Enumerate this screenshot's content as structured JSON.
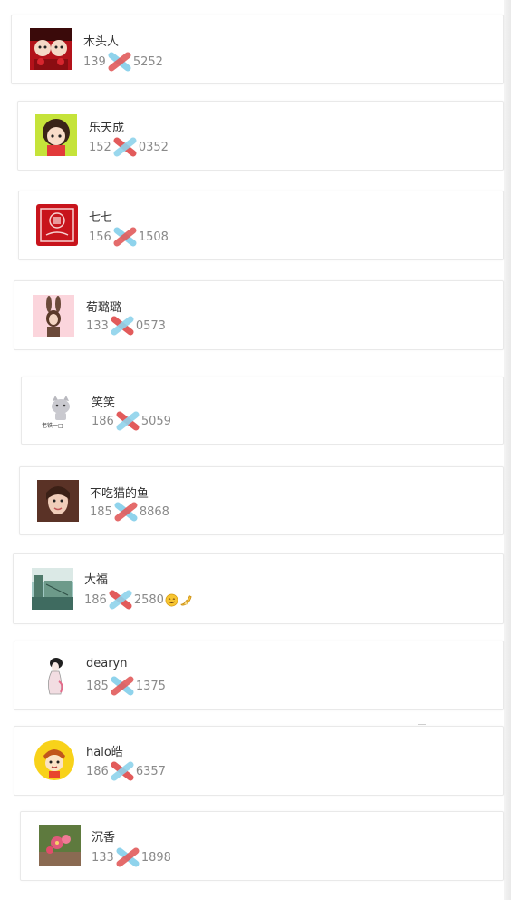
{
  "contacts": [
    {
      "name": "木头人",
      "phone_prefix": "139",
      "phone_suffix": "5252",
      "avatar_icon": "red-doll-avatar-icon"
    },
    {
      "name": "乐天成",
      "phone_prefix": "152",
      "phone_suffix": "0352",
      "avatar_icon": "cartoon-girl-avatar-icon"
    },
    {
      "name": "七七",
      "phone_prefix": "156",
      "phone_suffix": "1508",
      "avatar_icon": "red-seal-avatar-icon"
    },
    {
      "name": "荀璐璐",
      "phone_prefix": "133",
      "phone_suffix": "0573",
      "avatar_icon": "bunny-girl-avatar-icon"
    },
    {
      "name": "笑笑",
      "phone_prefix": "186",
      "phone_suffix": "5059",
      "avatar_icon": "gray-cat-avatar-icon",
      "avatar_caption": "老铁一□"
    },
    {
      "name": "不吃猫的鱼",
      "phone_prefix": "185",
      "phone_suffix": "8868",
      "avatar_icon": "selfie-girl-avatar-icon"
    },
    {
      "name": "大福",
      "phone_prefix": "186",
      "phone_suffix": "2580",
      "avatar_icon": "street-scene-avatar-icon",
      "emojis": [
        "smile-emoji-icon",
        "banana-emoji-icon"
      ]
    },
    {
      "name": "dearyn",
      "phone_prefix": "185",
      "phone_suffix": "1375",
      "avatar_icon": "sketch-girl-avatar-icon"
    },
    {
      "name": "halo皓",
      "phone_prefix": "186",
      "phone_suffix": "6357",
      "avatar_icon": "yellow-cartoon-avatar-icon"
    },
    {
      "name": "沉香",
      "phone_prefix": "133",
      "phone_suffix": "1898",
      "avatar_icon": "flower-photo-avatar-icon"
    }
  ],
  "mask_colors": {
    "red": "#e25b5b",
    "blue": "#8fd3ec"
  }
}
